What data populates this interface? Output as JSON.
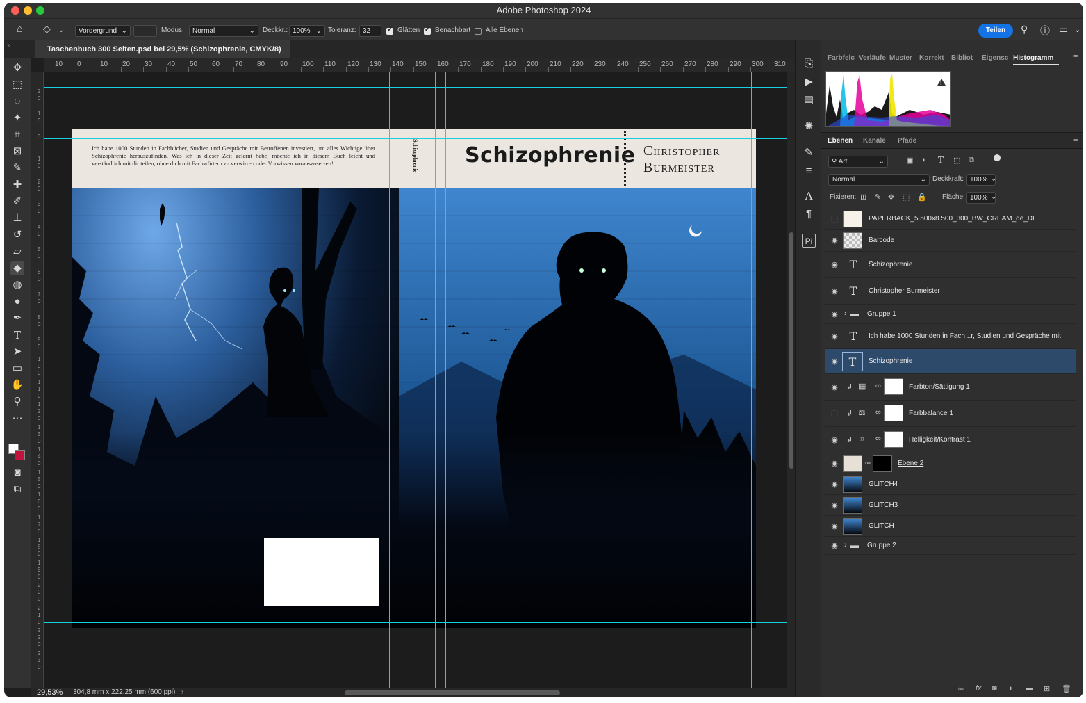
{
  "app": {
    "title": "Adobe Photoshop 2024",
    "share_label": "Teilen",
    "colors": {
      "accent": "#1473e6",
      "guide": "#18d0e0",
      "selected_layer": "#2e4a6b"
    }
  },
  "options_bar": {
    "fill_source": "Vordergrund",
    "mode_label": "Modus:",
    "mode_value": "Normal",
    "opacity_label": "Deckkr.:",
    "opacity_value": "100%",
    "tolerance_label": "Toleranz:",
    "tolerance_value": "32",
    "antialias_label": "Glätten",
    "antialias_checked": true,
    "contiguous_label": "Benachbart",
    "contiguous_checked": true,
    "all_layers_label": "Alle Ebenen",
    "all_layers_checked": false
  },
  "document": {
    "tab_title": "Taschenbuch 300 Seiten.psd bei 29,5% (Schizophrenie, CMYK/8)",
    "ruler_ticks": [
      "10",
      "0",
      "10",
      "20",
      "30",
      "40",
      "50",
      "60",
      "70",
      "80",
      "90",
      "100",
      "110",
      "120",
      "130",
      "140",
      "150",
      "160",
      "170",
      "180",
      "190",
      "200",
      "210",
      "220",
      "230",
      "240",
      "250",
      "260",
      "270",
      "280",
      "290",
      "300",
      "310"
    ],
    "zoom": "29,53%",
    "doc_info": "304,8 mm x 222,25 mm (600 ppi)"
  },
  "cover": {
    "blurb": "Ich habe 1000 Stunden in Fachbücher, Studien und Gespräche mit Betroffenen investiert, um alles Wichtige über Schizophrenie herauszufinden. Was ich in dieser Zeit gelernt habe, möchte ich in diesem Buch leicht und verständlich mit dir teilen, ohne dich mit Fachwörtern zu verwirren oder Vorwissen vorauszusetzen!",
    "spine_title": "Schizophrenie",
    "front_title": "Schizophrenie",
    "author_line1": "Christopher",
    "author_line2": "Burmeister"
  },
  "panels": {
    "top_tabs": [
      "Farbfelc",
      "Verläufe",
      "Muster",
      "Korrekt",
      "Bibliot",
      "Eigensc",
      "Histogramm"
    ],
    "layer_tabs": [
      "Ebenen",
      "Kanäle",
      "Pfade"
    ],
    "filter_kind": "Art",
    "blend_mode": "Normal",
    "opacity_label": "Deckkraft:",
    "opacity_value": "100%",
    "lock_label": "Fixieren:",
    "fill_label": "Fläche:",
    "fill_value": "100%"
  },
  "layers": [
    {
      "name": "PAPERBACK_5.500x8.500_300_BW_CREAM_de_DE",
      "type": "image",
      "visible": false
    },
    {
      "name": "Barcode",
      "type": "smart",
      "visible": true
    },
    {
      "name": "Schizophrenie",
      "type": "text",
      "visible": true
    },
    {
      "name": "Christopher Burmeister",
      "type": "text",
      "visible": true
    },
    {
      "name": "Gruppe 1",
      "type": "group",
      "visible": true
    },
    {
      "name": "Ich habe 1000 Stunden in Fach...r, Studien und Gespräche mit",
      "type": "text",
      "visible": true
    },
    {
      "name": "Schizophrenie",
      "type": "text",
      "visible": true,
      "selected": true
    },
    {
      "name": "Farbton/Sättigung 1",
      "type": "adjustment",
      "visible": true
    },
    {
      "name": "Farbbalance 1",
      "type": "adjustment",
      "visible": false
    },
    {
      "name": "Helligkeit/Kontrast 1",
      "type": "adjustment",
      "visible": true
    },
    {
      "name": "Ebene 2",
      "type": "image-mask",
      "visible": true
    },
    {
      "name": "GLITCH4",
      "type": "image",
      "visible": true
    },
    {
      "name": "GLITCH3",
      "type": "image",
      "visible": true
    },
    {
      "name": "GLITCH",
      "type": "image",
      "visible": true
    },
    {
      "name": "Gruppe 2",
      "type": "group",
      "visible": true
    }
  ]
}
